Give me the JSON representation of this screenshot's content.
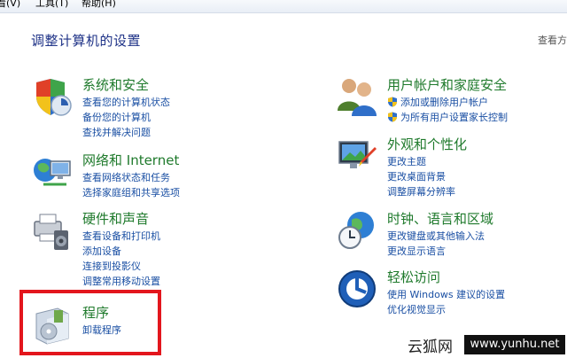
{
  "menubar": {
    "items": [
      {
        "label": "看(V)"
      },
      {
        "label": "工具(T)"
      },
      {
        "label": "帮助(H)"
      }
    ]
  },
  "page": {
    "title": "调整计算机的设置",
    "view_by": "查看方"
  },
  "categories": {
    "system_security": {
      "title": "系统和安全",
      "links": [
        "查看您的计算机状态",
        "备份您的计算机",
        "查找并解决问题"
      ]
    },
    "network": {
      "title": "网络和 Internet",
      "links": [
        "查看网络状态和任务",
        "选择家庭组和共享选项"
      ]
    },
    "hardware": {
      "title": "硬件和声音",
      "links": [
        "查看设备和打印机",
        "添加设备",
        "连接到投影仪",
        "调整常用移动设置"
      ]
    },
    "programs": {
      "title": "程序",
      "links": [
        "卸载程序"
      ]
    },
    "user_accounts": {
      "title": "用户帐户和家庭安全",
      "links": [
        "添加或删除用户帐户",
        "为所有用户设置家长控制"
      ]
    },
    "appearance": {
      "title": "外观和个性化",
      "links": [
        "更改主题",
        "更改桌面背景",
        "调整屏幕分辨率"
      ]
    },
    "clock": {
      "title": "时钟、语言和区域",
      "links": [
        "更改键盘或其他输入法",
        "更改显示语言"
      ]
    },
    "ease": {
      "title": "轻松访问",
      "links": [
        "使用 Windows 建议的设置",
        "优化视觉显示"
      ]
    }
  },
  "watermark": {
    "left": "云狐网",
    "right": "www.yunhu.net"
  },
  "colors": {
    "category_title": "#1f7a2c",
    "link": "#1a4fa3",
    "highlight": "#e3161d"
  }
}
